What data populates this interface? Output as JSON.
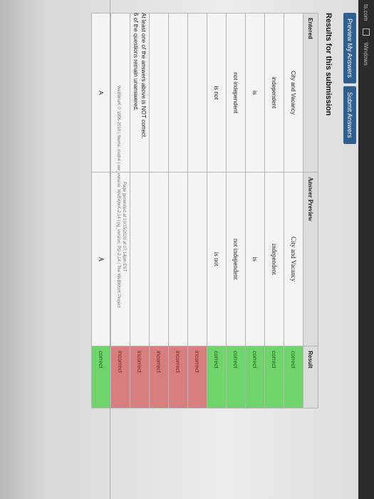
{
  "tabs": {
    "tab1": "ts.com",
    "tab2": "Windows"
  },
  "buttons": {
    "preview": "Preview My Answers",
    "submit": "Submit Answers"
  },
  "heading": "Results for this submission",
  "table": {
    "headers": {
      "entered": "Entered",
      "preview": "Answer Preview",
      "result": "Result"
    },
    "rows": [
      {
        "entered": "City and Vacancy",
        "preview": "City and Vacancy",
        "result": "correct",
        "status": "correct"
      },
      {
        "entered": "independent",
        "preview": "independent",
        "result": "correct",
        "status": "correct"
      },
      {
        "entered": "is",
        "preview": "is",
        "result": "correct",
        "status": "correct"
      },
      {
        "entered": "not independent",
        "preview": "not independent",
        "result": "correct",
        "status": "correct"
      },
      {
        "entered": "is not",
        "preview": "is not",
        "result": "correct",
        "status": "correct"
      },
      {
        "entered": "",
        "preview": "",
        "result": "incorrect",
        "status": "incorrect"
      },
      {
        "entered": "",
        "preview": "",
        "result": "incorrect",
        "status": "incorrect"
      },
      {
        "entered": "",
        "preview": "",
        "result": "incorrect",
        "status": "incorrect"
      },
      {
        "entered": "",
        "preview": "",
        "result": "incorrect",
        "status": "incorrect"
      },
      {
        "entered": "",
        "preview": "",
        "result": "incorrect",
        "status": "incorrect"
      },
      {
        "entered": "A",
        "preview": "A",
        "result": "correct",
        "status": "correct"
      }
    ]
  },
  "messages": {
    "line1": "At least one of the answers above is NOT correct.",
    "line2": "6 of the questions remain unanswered."
  },
  "page_generated": "Page generated at 10/15/2020 at 07:14pm EST",
  "copyright": "WeBWorK © 1996-2019 | theme: math4 | ww_version: WeBWorK-2.14 | pg_version: PG-2.14 | The WeBWorK Project",
  "colors": {
    "correct": "#6fd46a",
    "incorrect": "#d77f7f",
    "button": "#2e5f8e"
  }
}
